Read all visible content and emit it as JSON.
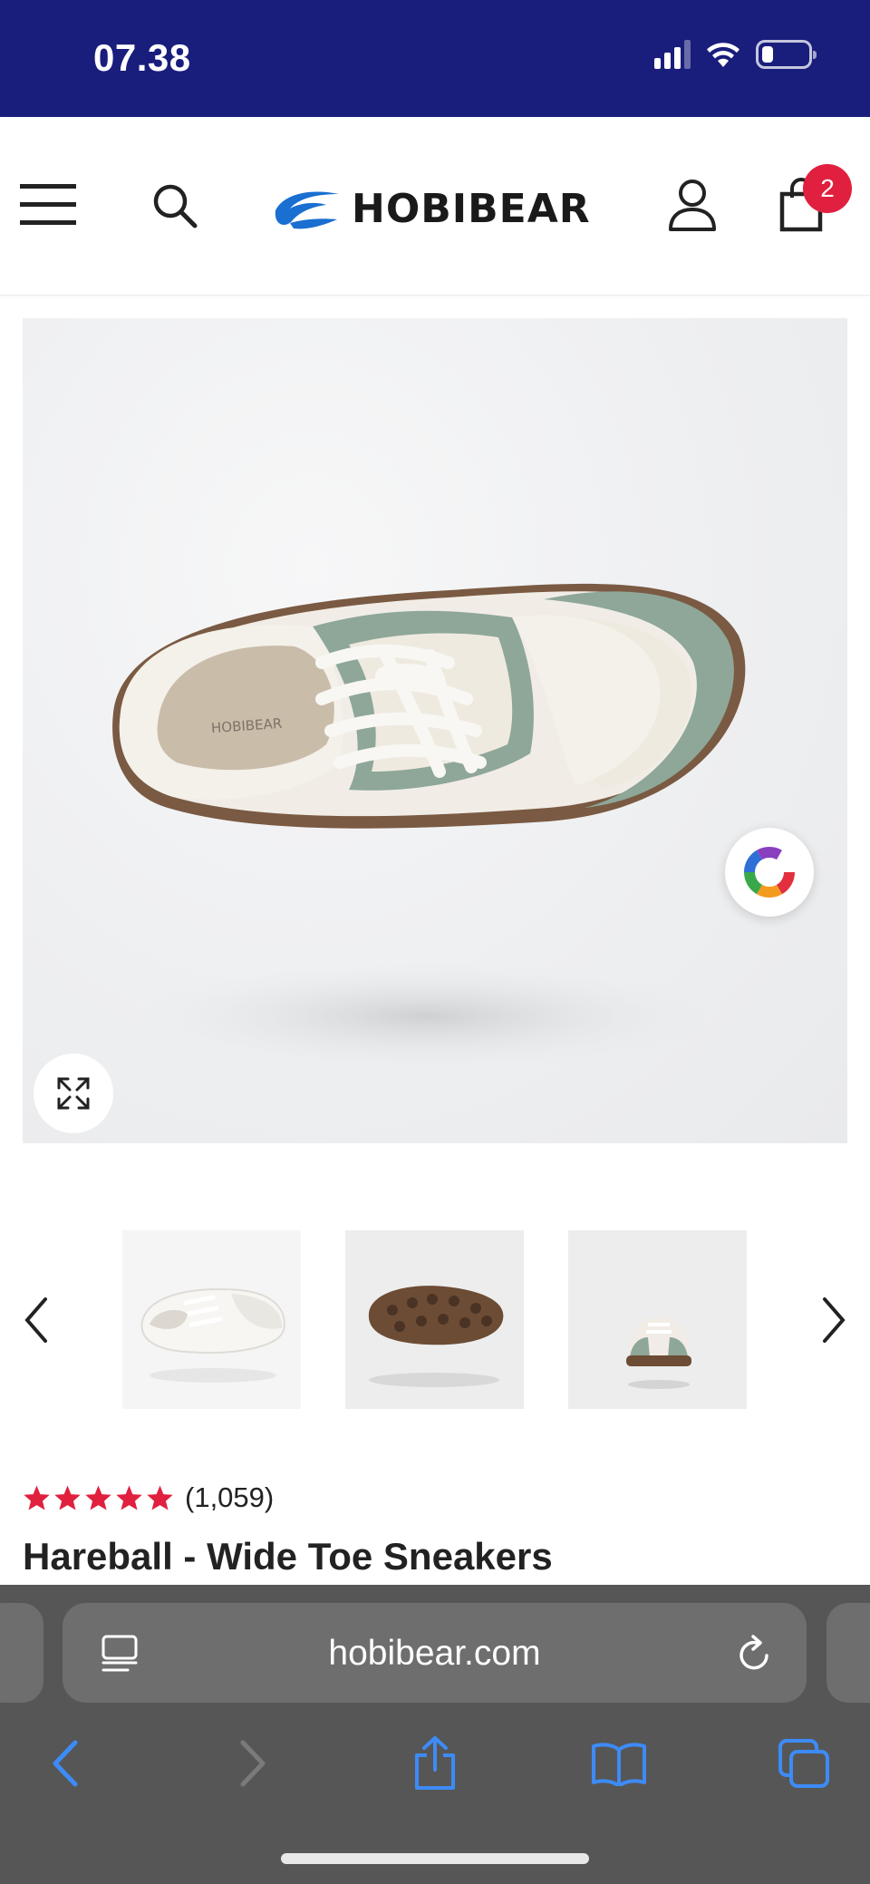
{
  "status_bar": {
    "time": "07.38",
    "battery_level": 0.2,
    "signal_bars": 3,
    "icons": [
      "signal-icon",
      "wifi-icon",
      "battery-icon"
    ]
  },
  "header": {
    "brand": "HOBIBEAR",
    "cart_count": "2",
    "icons": [
      "menu-icon",
      "search-icon",
      "logo-icon",
      "account-icon",
      "cart-icon"
    ]
  },
  "gallery": {
    "main_image": "hareball-top-view",
    "thumbnails": [
      "white-sneaker-side",
      "brown-sole",
      "green-sneaker-front"
    ],
    "icons": [
      "color-swatch-icon",
      "expand-icon",
      "chevron-left-icon",
      "chevron-right-icon"
    ]
  },
  "product": {
    "rating": 5,
    "review_count": "(1,059)",
    "title": "Hareball - Wide Toe Sneakers"
  },
  "browser": {
    "url": "hobibear.com",
    "icons": [
      "reader-icon",
      "reload-icon",
      "back-icon",
      "forward-icon",
      "share-icon",
      "bookmarks-icon",
      "tabs-icon"
    ]
  },
  "colors": {
    "status_bar_bg": "#191e7c",
    "brand_blue": "#1a6fd1",
    "badge_red": "#e0203e",
    "star_red": "#e0203e",
    "browser_bg": "#565656",
    "browser_accent": "#3d8bf7"
  }
}
